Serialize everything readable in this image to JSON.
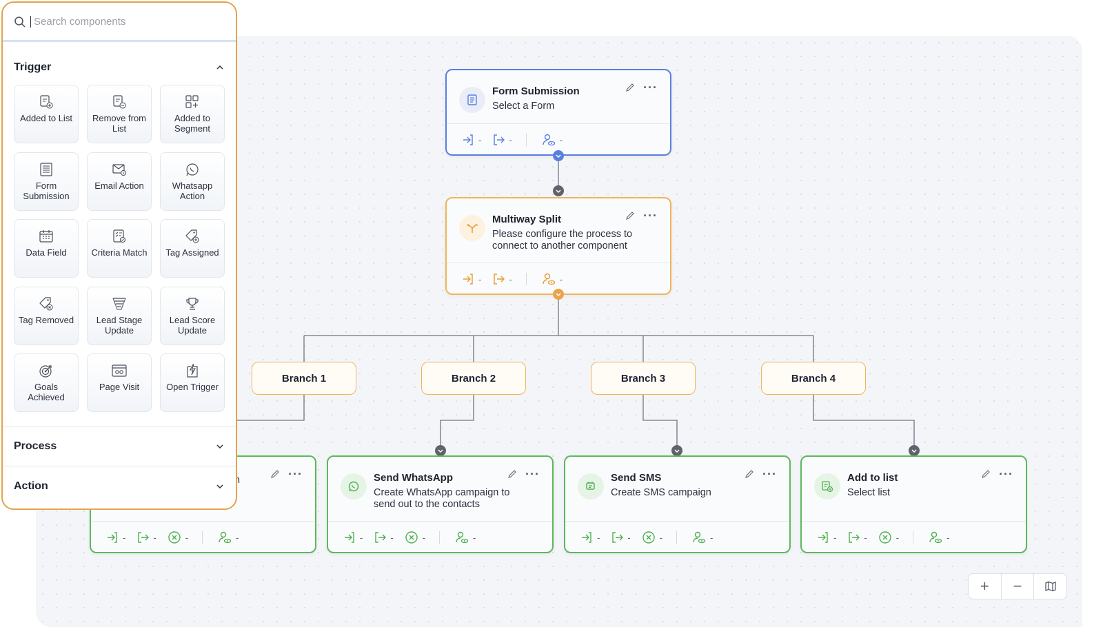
{
  "panel": {
    "search_placeholder": "Search components",
    "sections": {
      "trigger": "Trigger",
      "process": "Process",
      "action": "Action"
    },
    "tiles": [
      {
        "label": "Added to List",
        "icon": "list-add-icon"
      },
      {
        "label": "Remove from List",
        "icon": "list-remove-icon"
      },
      {
        "label": "Added to Segment",
        "icon": "segment-icon"
      },
      {
        "label": "Form Submission",
        "icon": "form-icon"
      },
      {
        "label": "Email Action",
        "icon": "email-icon"
      },
      {
        "label": "Whatsapp Action",
        "icon": "whatsapp-icon"
      },
      {
        "label": "Data Field",
        "icon": "calendar-icon"
      },
      {
        "label": "Criteria Match",
        "icon": "criteria-icon"
      },
      {
        "label": "Tag Assigned",
        "icon": "tag-add-icon"
      },
      {
        "label": "Tag Removed",
        "icon": "tag-remove-icon"
      },
      {
        "label": "Lead Stage Update",
        "icon": "funnel-icon"
      },
      {
        "label": "Lead Score Update",
        "icon": "trophy-icon"
      },
      {
        "label": "Goals Achieved",
        "icon": "target-icon"
      },
      {
        "label": "Page Visit",
        "icon": "browser-icon"
      },
      {
        "label": "Open Trigger",
        "icon": "bolt-icon"
      }
    ]
  },
  "nodes": {
    "form": {
      "title": "Form Submission",
      "subtitle": "Select a Form"
    },
    "split": {
      "title": "Multiway Split",
      "subtitle": "Please configure the process to connect to another component"
    },
    "hidden": {
      "subtitle_tail": "n"
    },
    "whatsapp": {
      "title": "Send WhatsApp",
      "subtitle": "Create WhatsApp campaign to send out to the contacts"
    },
    "sms": {
      "title": "Send SMS",
      "subtitle": "Create SMS campaign"
    },
    "addlist": {
      "title": "Add to list",
      "subtitle": "Select list"
    }
  },
  "branches": [
    "Branch 1",
    "Branch 2",
    "Branch 3",
    "Branch 4"
  ],
  "footer_dash": "-",
  "more_glyph": "···",
  "zoom": {
    "in": "+",
    "out": "−"
  },
  "colors": {
    "blue": "#5b7fe0",
    "orange": "#f0b45a",
    "green": "#5cb85c",
    "panel_border": "#e4a24a"
  }
}
